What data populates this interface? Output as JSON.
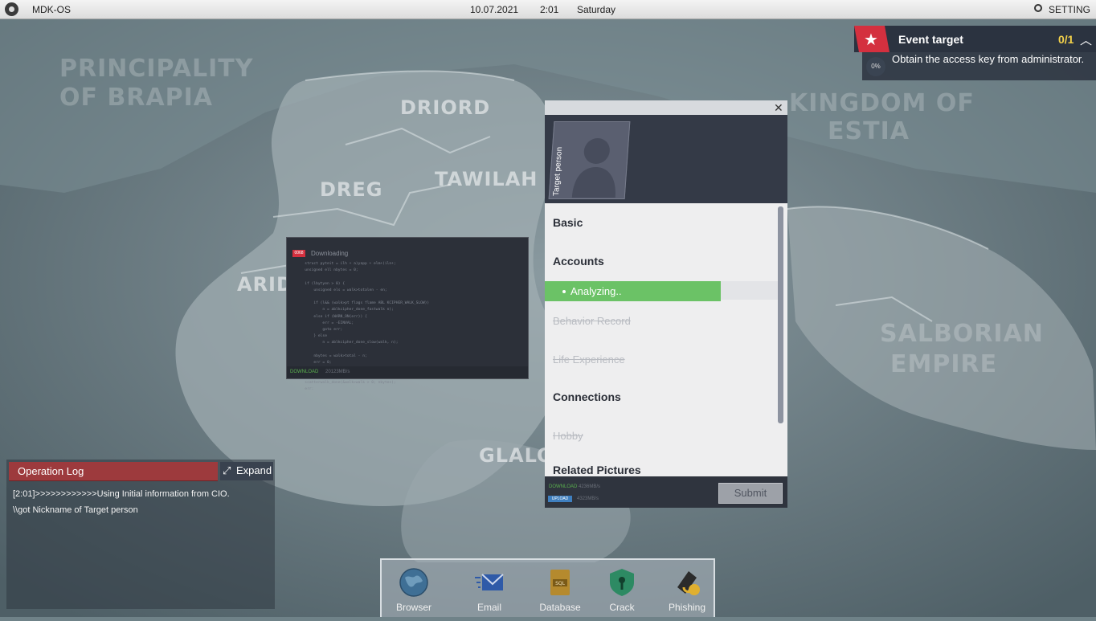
{
  "topbar": {
    "os_name": "MDK-OS",
    "date": "10.07.2021",
    "time": "2:01",
    "day": "Saturday",
    "setting_label": "SETTING"
  },
  "map": {
    "labels": [
      "PRINCIPALITY",
      "OF BRAPIA",
      "DRIORD",
      "DREG",
      "TAWILAH",
      "ARID",
      "KINGDOM OF",
      "ESTIA",
      "SALBORIAN",
      "EMPIRE",
      "GLALO"
    ]
  },
  "event_target": {
    "title": "Event target",
    "count": "0/1",
    "progress": "0%",
    "description": "Obtain the access key from administrator."
  },
  "download_window": {
    "badge": "0068",
    "title": "Downloading",
    "code_lines": [
      "   struct pyteit = ilh + a)yapp + elm+(iln+;",
      "   unsigned ell nbytes = 0;",
      "",
      "   if (lbytyen &gt; 0) {",
      "       unsigned els = walk&gt;totalen - en;",
      "",
      "       if (l&amp;&amp; (walk&gt;pt flags flame ABL KCIPHER_WALK_SLOW))",
      "           n = ablkcipher_done_fastwalk n);",
      "       else if (WARN_ON(err)) {",
      "           err = -EINVAL;",
      "           goto err;",
      "       } else",
      "           n = ablkcipher_done_slow(walk, n);",
      "",
      "       nbytes = walk&gt;total - n;",
      "       err = 0;",
      "   }",
      "",
      "   scatterwalk_done(&amp;walk&gt;walk &gt; 0; nbytes);",
      "   err:"
    ],
    "download_label": "DOWNLOAD",
    "download_speed": "20123MB/s"
  },
  "target_window": {
    "card_label": "Target person",
    "items": {
      "basic": "Basic",
      "accounts": "Accounts",
      "analyzing": "Analyzing..",
      "behavior": "Behavior Record",
      "life": "Life Experience",
      "connections": "Connections",
      "hobby": "Hobby",
      "pictures": "Related Pictures"
    },
    "download_label": "DOWNLOAD",
    "download_speed": "4236MB/s",
    "upload_label": "UPLOAD",
    "upload_speed": "4323MB/s",
    "submit_label": "Submit"
  },
  "operation_log": {
    "title": "Operation Log",
    "expand_label": "Expand",
    "lines": [
      "[2:01]>>>>>>>>>>>>Using Initial information from CIO.",
      "\\\\got Nickname of Target person"
    ]
  },
  "dock": {
    "items": [
      {
        "label": "Browser",
        "icon": "globe-icon",
        "color": "#3f6f95"
      },
      {
        "label": "Email",
        "icon": "envelope-icon",
        "color": "#2f5aa8"
      },
      {
        "label": "Database",
        "icon": "sql-database-icon",
        "color": "#b58a2e"
      },
      {
        "label": "Crack",
        "icon": "shield-key-icon",
        "color": "#2d8a63"
      },
      {
        "label": "Phishing",
        "icon": "hook-icon",
        "color": "#2b2b2b"
      }
    ]
  }
}
